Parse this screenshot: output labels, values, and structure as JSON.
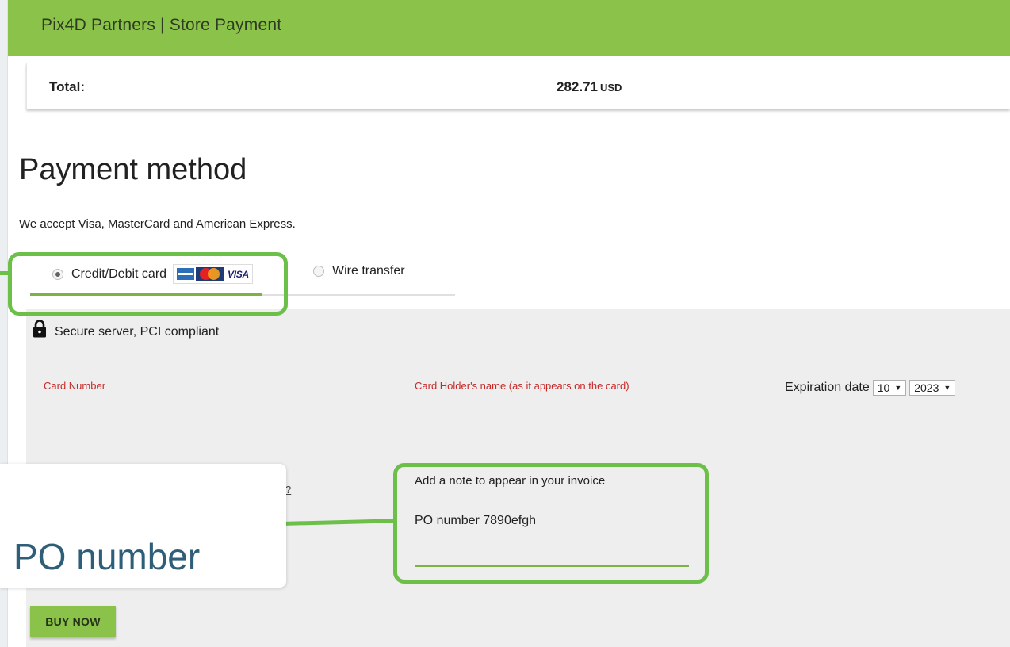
{
  "header": {
    "title": "Pix4D Partners | Store Payment"
  },
  "summary": {
    "total_label": "Total:",
    "total_value": "282.71",
    "currency": "USD"
  },
  "payment": {
    "heading": "Payment method",
    "accepted_text": "We accept Visa, MasterCard and American Express.",
    "tabs": [
      {
        "label": "Credit/Debit card",
        "selected": true
      },
      {
        "label": "Wire transfer",
        "selected": false
      }
    ],
    "card_logos": {
      "amex_icon": "amex-logo",
      "mastercard_icon": "mastercard-logo",
      "visa": "VISA"
    },
    "secure_text": "Secure server, PCI compliant",
    "card_number_label": "Card Number",
    "card_holder_label": "Card Holder's name (as it appears on the card)",
    "expiration_label": "Expiration date",
    "expiration_month": "10",
    "expiration_year": "2023",
    "partial_text": "?",
    "note_label": "Add a note to appear in your invoice",
    "note_value": "PO number 7890efgh",
    "buy_button": "BUY NOW"
  },
  "annotation": {
    "callout_text": "PO number",
    "highlight_color": "#6cc04a"
  },
  "colors": {
    "header_green": "#8bc34a",
    "error_red": "#c62828",
    "panel_gray": "#eeeeee"
  }
}
